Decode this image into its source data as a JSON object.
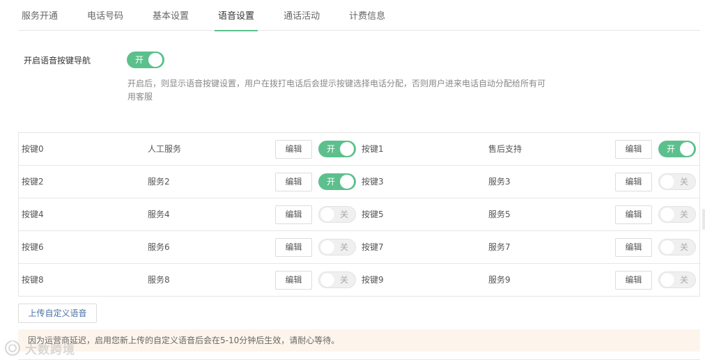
{
  "tabs": [
    {
      "label": "服务开通"
    },
    {
      "label": "电话号码"
    },
    {
      "label": "基本设置"
    },
    {
      "label": "语音设置"
    },
    {
      "label": "通话活动"
    },
    {
      "label": "计费信息"
    }
  ],
  "active_tab": "语音设置",
  "voice_nav": {
    "label": "开启语音按键导航",
    "toggle_state": "开",
    "enabled": true,
    "description": "开启后，则显示语音按键设置，用户在拨打电话后会提示按键选择电话分配，否则用户进来电话自动分配给所有可用客服"
  },
  "edit_label": "编辑",
  "toggle_labels": {
    "on": "开",
    "off": "关"
  },
  "keys": [
    {
      "key": "按键0",
      "service": "人工服务",
      "enabled": true,
      "state": "开"
    },
    {
      "key": "按键1",
      "service": "售后支持",
      "enabled": true,
      "state": "开"
    },
    {
      "key": "按键2",
      "service": "服务2",
      "enabled": true,
      "state": "开"
    },
    {
      "key": "按键3",
      "service": "服务3",
      "enabled": false,
      "state": "关"
    },
    {
      "key": "按键4",
      "service": "服务4",
      "enabled": false,
      "state": "关"
    },
    {
      "key": "按键5",
      "service": "服务5",
      "enabled": false,
      "state": "关"
    },
    {
      "key": "按键6",
      "service": "服务6",
      "enabled": false,
      "state": "关"
    },
    {
      "key": "按键7",
      "service": "服务7",
      "enabled": false,
      "state": "关"
    },
    {
      "key": "按键8",
      "service": "服务8",
      "enabled": false,
      "state": "关"
    },
    {
      "key": "按键9",
      "service": "服务9",
      "enabled": false,
      "state": "关"
    }
  ],
  "upload_button": "上传自定义语音",
  "notice": "因为运营商延迟，启用您新上传的自定义语音后会在5-10分钟后生效，请耐心等待。",
  "watermark": {
    "text": "大数跨境"
  },
  "colors": {
    "accent": "#5cc08c",
    "notice_bg": "#fdf5eb",
    "link": "#4a6fa5"
  }
}
